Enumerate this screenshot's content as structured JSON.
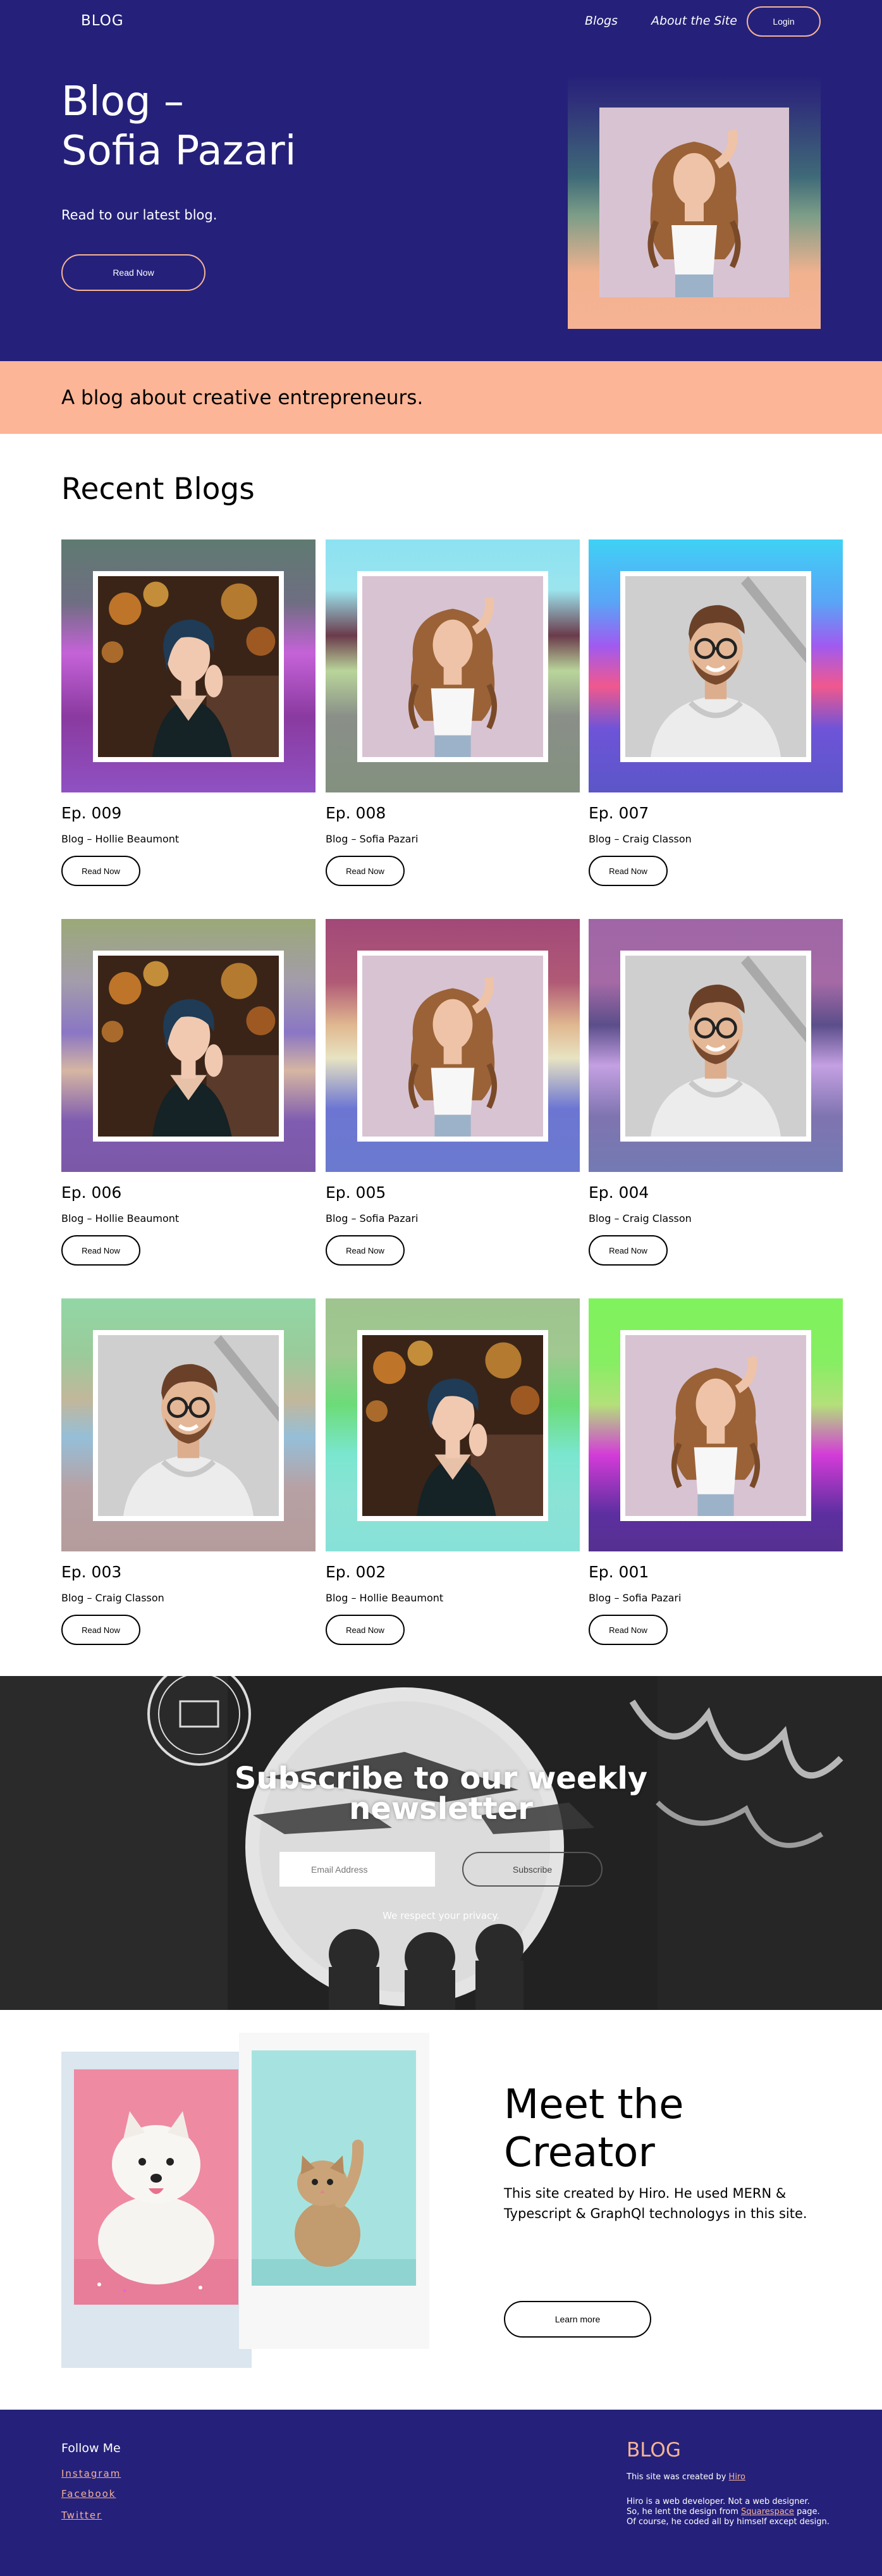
{
  "header": {
    "logo": "BLOG",
    "nav": {
      "blogs": "Blogs",
      "about": "About the Site"
    },
    "login": "Login"
  },
  "hero": {
    "title_line1": "Blog –",
    "title_line2": "Sofia Pazari",
    "subtitle": "Read to our latest blog.",
    "button": "Read Now"
  },
  "tagline": "A blog about creative entrepreneurs.",
  "recent": {
    "title": "Recent Blogs",
    "read_label": "Read Now",
    "cards": [
      {
        "ep": "Ep. 009",
        "author": "Blog – Hollie Beaumont",
        "photo": "hollie-portrait"
      },
      {
        "ep": "Ep. 008",
        "author": "Blog – Sofia Pazari",
        "photo": "sofia-portrait"
      },
      {
        "ep": "Ep. 007",
        "author": "Blog – Craig Classon",
        "photo": "craig-portrait"
      },
      {
        "ep": "Ep. 006",
        "author": "Blog – Hollie Beaumont",
        "photo": "hollie-portrait"
      },
      {
        "ep": "Ep. 005",
        "author": "Blog – Sofia Pazari",
        "photo": "sofia-portrait"
      },
      {
        "ep": "Ep. 004",
        "author": "Blog – Craig Classon",
        "photo": "craig-portrait"
      },
      {
        "ep": "Ep. 003",
        "author": "Blog – Craig Classon",
        "photo": "craig-portrait"
      },
      {
        "ep": "Ep. 002",
        "author": "Blog – Hollie Beaumont",
        "photo": "hollie-portrait"
      },
      {
        "ep": "Ep. 001",
        "author": "Blog – Sofia Pazari",
        "photo": "sofia-portrait"
      }
    ]
  },
  "newsletter": {
    "title_line1": "Subscribe to our weekly",
    "title_line2": "newsletter",
    "email_placeholder": "Email Address",
    "subscribe": "Subscribe",
    "privacy": "We respect your privacy."
  },
  "creator": {
    "title_line1": "Meet the",
    "title_line2": "Creator",
    "description": "This site created by Hiro. He used MERN & Typescript & GraphQl technologys in this site.",
    "button": "Learn more"
  },
  "footer": {
    "follow": "Follow Me",
    "social": [
      "Instagram",
      "Facebook",
      "Twitter"
    ],
    "logo": "BLOG",
    "credit_prefix": "This site was created by ",
    "credit_name": "Hiro",
    "bio_line1": "Hiro is a web developer. Not a web designer.",
    "bio_line2_prefix": "So, he lent the design from ",
    "bio_line2_link": "Squarespace",
    "bio_line2_suffix": " page.",
    "bio_line3": "Of course, he coded all by himself except design."
  },
  "colors": {
    "navy": "#25217a",
    "peach": "#fcb596",
    "accent": "#f6b496"
  }
}
